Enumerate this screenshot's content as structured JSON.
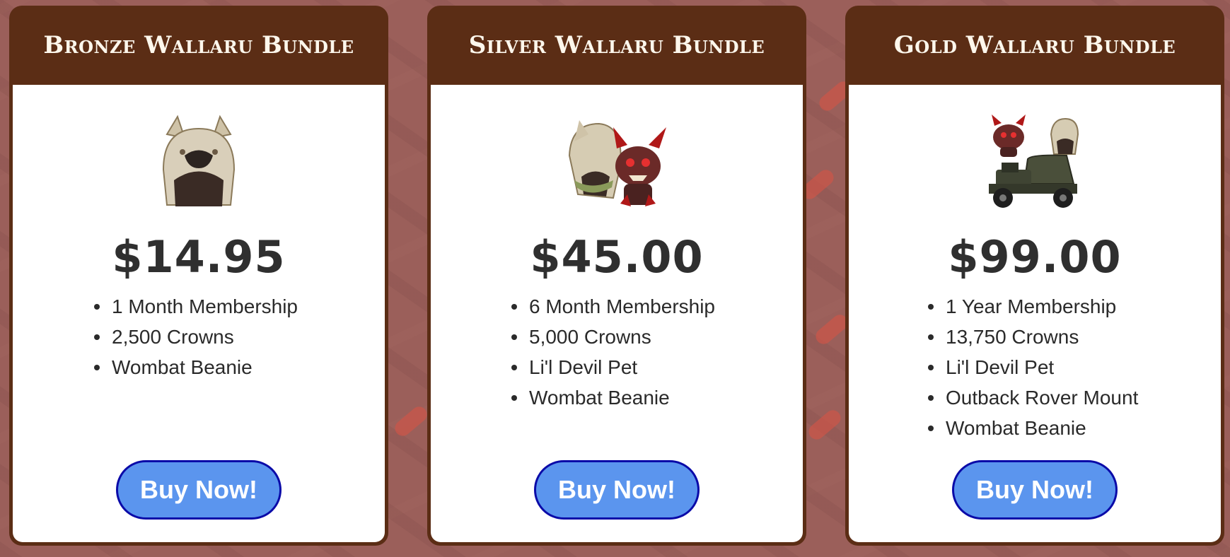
{
  "colors": {
    "background": "#9b5f5a",
    "card_frame": "#5b2d15",
    "card_body": "#ffffff",
    "button_fill": "#5b95ee",
    "button_border": "#0a0aa8",
    "button_text": "#ffffff",
    "header_text": "#fdf7ec"
  },
  "bundles": [
    {
      "title": "Bronze Wallaru Bundle",
      "image": "wombat-beanie-icon",
      "price": "$14.95",
      "items": [
        "1 Month Membership",
        "2,500 Crowns",
        "Wombat Beanie"
      ],
      "button_label": "Buy Now!"
    },
    {
      "title": "Silver Wallaru Bundle",
      "image": "beanie-and-devil-pet-icon",
      "price": "$45.00",
      "items": [
        "6 Month Membership",
        "5,000 Crowns",
        "Li'l Devil Pet",
        "Wombat Beanie"
      ],
      "button_label": "Buy Now!"
    },
    {
      "title": "Gold Wallaru Bundle",
      "image": "beanie-devil-pet-rover-icon",
      "price": "$99.00",
      "items": [
        "1 Year Membership",
        "13,750 Crowns",
        "Li'l Devil Pet",
        "Outback Rover Mount",
        "Wombat Beanie"
      ],
      "button_label": "Buy Now!"
    }
  ]
}
